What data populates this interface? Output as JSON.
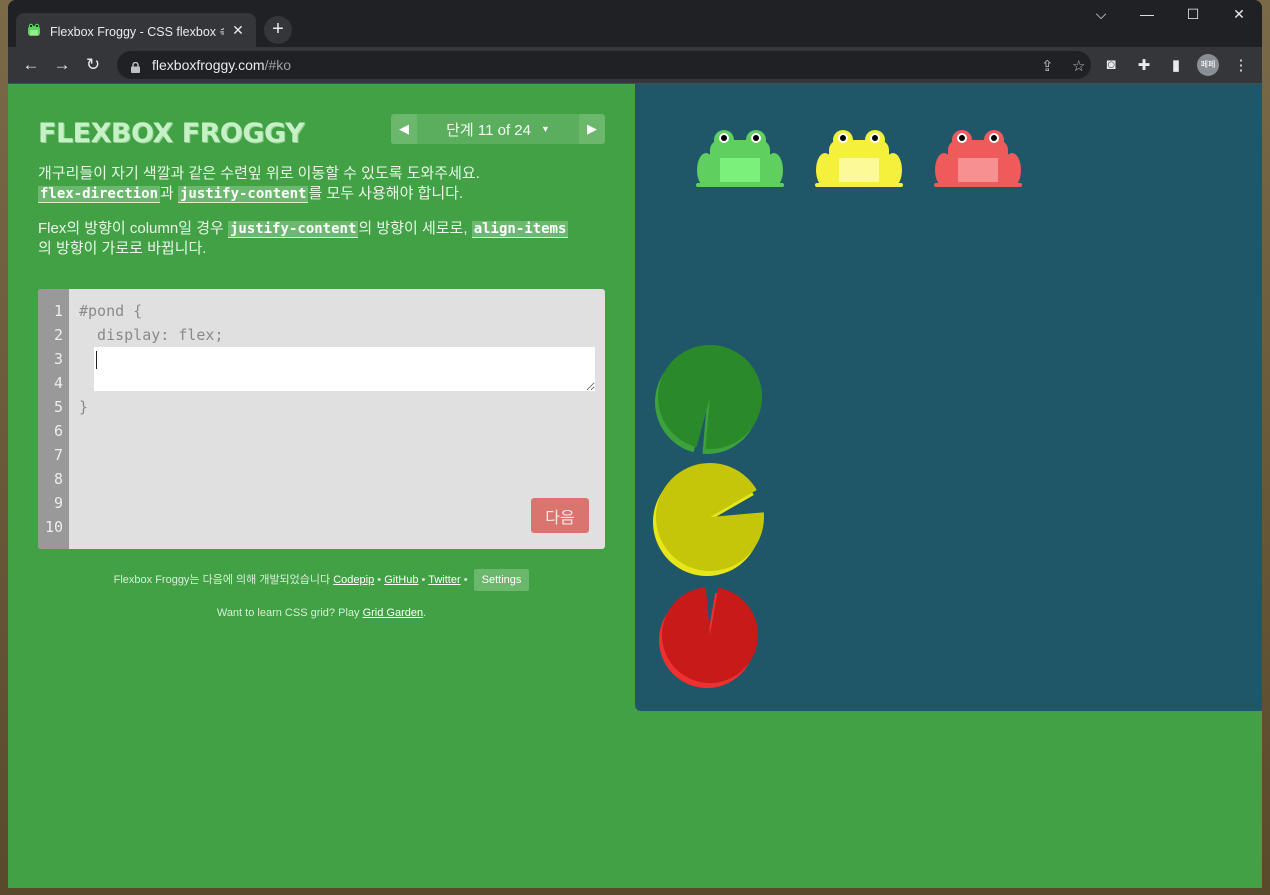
{
  "browser": {
    "tab_title": "Flexbox Froggy - CSS flexbox 속",
    "new_tab": "+",
    "close_tab": "✕",
    "url_host": "flexboxfroggy.com",
    "url_path": "/#ko",
    "avatar_text": "페페",
    "window_controls": {
      "chevron": "⌵",
      "minimize": "—",
      "maximize": "☐",
      "close": "✕"
    }
  },
  "game": {
    "logo": "FLEXBOX FROGGY",
    "level_label": "단계 11 of 24",
    "level_caret": "▼",
    "prev_arrow": "◀",
    "next_arrow": "▶",
    "instructions": {
      "p1_text": "개구리들이 자기 색깔과 같은 수련잎 위로 이동할 수 있도록 도와주세요.",
      "p1_code1": "flex-direction",
      "p1_mid": "과",
      "p1_code2": "justify-content",
      "p1_end": "를 모두 사용해야 합니다.",
      "p2_start": "Flex의 방향이 column일 경우",
      "p2_code1": "justify-content",
      "p2_mid": "의 방향이 세로로,",
      "p2_code2": "align-items",
      "p2_end": "의 방향이 가로로 바뀝니다."
    },
    "editor": {
      "line_numbers": [
        "1",
        "2",
        "3",
        "4",
        "5",
        "6",
        "7",
        "8",
        "9",
        "10"
      ],
      "line1": "#pond {",
      "line2": "  display: flex;",
      "line5": "}",
      "input_value": "",
      "next_button": "다음"
    },
    "credits": {
      "prefix": "Flexbox Froggy는 다음에 의해 개발되었습니다",
      "link_codepip": "Codepip",
      "sep": "•",
      "link_github": "GitHub",
      "link_twitter": "Twitter",
      "settings": "Settings"
    },
    "grid_note": {
      "text": "Want to learn CSS grid? Play",
      "link": "Grid Garden",
      "end": "."
    }
  },
  "pond": {
    "frogs": [
      {
        "color": "green",
        "body": "#5fcf5f",
        "belly": "#7bf07b"
      },
      {
        "color": "yellow",
        "body": "#f4f03c",
        "belly": "#fbfa96"
      },
      {
        "color": "red",
        "body": "#ef5a5a",
        "belly": "#f79090"
      }
    ],
    "lilypads": [
      {
        "color": "green",
        "fill": "#2a8a2a",
        "shade": "#3da13d"
      },
      {
        "color": "yellow",
        "fill": "#c5c60a",
        "shade": "#e6e61a"
      },
      {
        "color": "red",
        "fill": "#c91a1a",
        "shade": "#ef3030"
      }
    ]
  }
}
